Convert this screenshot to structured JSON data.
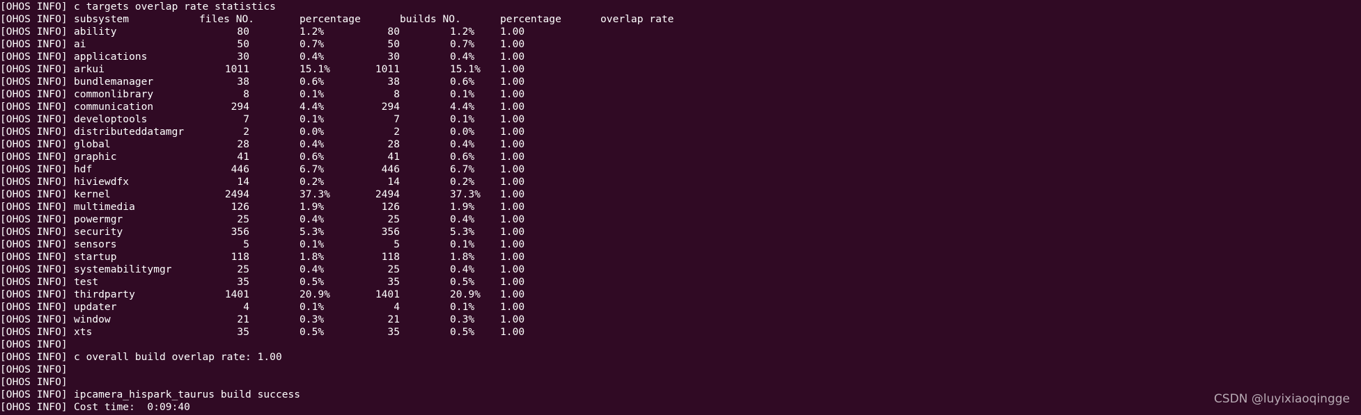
{
  "prefix": "[OHOS INFO]",
  "title": "c targets overlap rate statistics",
  "headers": {
    "subsystem": "subsystem",
    "files": "files NO.",
    "percentage1": "percentage",
    "builds": "builds NO.",
    "percentage2": "percentage",
    "overlap": "overlap rate"
  },
  "rows": [
    {
      "subsystem": "ability",
      "files": "80",
      "pct1": "1.2%",
      "builds": "80",
      "pct2": "1.2%",
      "overlap": "1.00"
    },
    {
      "subsystem": "ai",
      "files": "50",
      "pct1": "0.7%",
      "builds": "50",
      "pct2": "0.7%",
      "overlap": "1.00"
    },
    {
      "subsystem": "applications",
      "files": "30",
      "pct1": "0.4%",
      "builds": "30",
      "pct2": "0.4%",
      "overlap": "1.00"
    },
    {
      "subsystem": "arkui",
      "files": "1011",
      "pct1": "15.1%",
      "builds": "1011",
      "pct2": "15.1%",
      "overlap": "1.00"
    },
    {
      "subsystem": "bundlemanager",
      "files": "38",
      "pct1": "0.6%",
      "builds": "38",
      "pct2": "0.6%",
      "overlap": "1.00"
    },
    {
      "subsystem": "commonlibrary",
      "files": "8",
      "pct1": "0.1%",
      "builds": "8",
      "pct2": "0.1%",
      "overlap": "1.00"
    },
    {
      "subsystem": "communication",
      "files": "294",
      "pct1": "4.4%",
      "builds": "294",
      "pct2": "4.4%",
      "overlap": "1.00"
    },
    {
      "subsystem": "developtools",
      "files": "7",
      "pct1": "0.1%",
      "builds": "7",
      "pct2": "0.1%",
      "overlap": "1.00"
    },
    {
      "subsystem": "distributeddatamgr",
      "files": "2",
      "pct1": "0.0%",
      "builds": "2",
      "pct2": "0.0%",
      "overlap": "1.00"
    },
    {
      "subsystem": "global",
      "files": "28",
      "pct1": "0.4%",
      "builds": "28",
      "pct2": "0.4%",
      "overlap": "1.00"
    },
    {
      "subsystem": "graphic",
      "files": "41",
      "pct1": "0.6%",
      "builds": "41",
      "pct2": "0.6%",
      "overlap": "1.00"
    },
    {
      "subsystem": "hdf",
      "files": "446",
      "pct1": "6.7%",
      "builds": "446",
      "pct2": "6.7%",
      "overlap": "1.00"
    },
    {
      "subsystem": "hiviewdfx",
      "files": "14",
      "pct1": "0.2%",
      "builds": "14",
      "pct2": "0.2%",
      "overlap": "1.00"
    },
    {
      "subsystem": "kernel",
      "files": "2494",
      "pct1": "37.3%",
      "builds": "2494",
      "pct2": "37.3%",
      "overlap": "1.00"
    },
    {
      "subsystem": "multimedia",
      "files": "126",
      "pct1": "1.9%",
      "builds": "126",
      "pct2": "1.9%",
      "overlap": "1.00"
    },
    {
      "subsystem": "powermgr",
      "files": "25",
      "pct1": "0.4%",
      "builds": "25",
      "pct2": "0.4%",
      "overlap": "1.00"
    },
    {
      "subsystem": "security",
      "files": "356",
      "pct1": "5.3%",
      "builds": "356",
      "pct2": "5.3%",
      "overlap": "1.00"
    },
    {
      "subsystem": "sensors",
      "files": "5",
      "pct1": "0.1%",
      "builds": "5",
      "pct2": "0.1%",
      "overlap": "1.00"
    },
    {
      "subsystem": "startup",
      "files": "118",
      "pct1": "1.8%",
      "builds": "118",
      "pct2": "1.8%",
      "overlap": "1.00"
    },
    {
      "subsystem": "systemabilitymgr",
      "files": "25",
      "pct1": "0.4%",
      "builds": "25",
      "pct2": "0.4%",
      "overlap": "1.00"
    },
    {
      "subsystem": "test",
      "files": "35",
      "pct1": "0.5%",
      "builds": "35",
      "pct2": "0.5%",
      "overlap": "1.00"
    },
    {
      "subsystem": "thirdparty",
      "files": "1401",
      "pct1": "20.9%",
      "builds": "1401",
      "pct2": "20.9%",
      "overlap": "1.00"
    },
    {
      "subsystem": "updater",
      "files": "4",
      "pct1": "0.1%",
      "builds": "4",
      "pct2": "0.1%",
      "overlap": "1.00"
    },
    {
      "subsystem": "window",
      "files": "21",
      "pct1": "0.3%",
      "builds": "21",
      "pct2": "0.3%",
      "overlap": "1.00"
    },
    {
      "subsystem": "xts",
      "files": "35",
      "pct1": "0.5%",
      "builds": "35",
      "pct2": "0.5%",
      "overlap": "1.00"
    }
  ],
  "footer": [
    "",
    "c overall build overlap rate: 1.00",
    "",
    "",
    "ipcamera_hispark_taurus build success",
    "Cost time:  0:09:40"
  ],
  "watermark": "CSDN @luyixiaoqingge",
  "colors": {
    "background": "#300a24",
    "text": "#ffffff"
  }
}
